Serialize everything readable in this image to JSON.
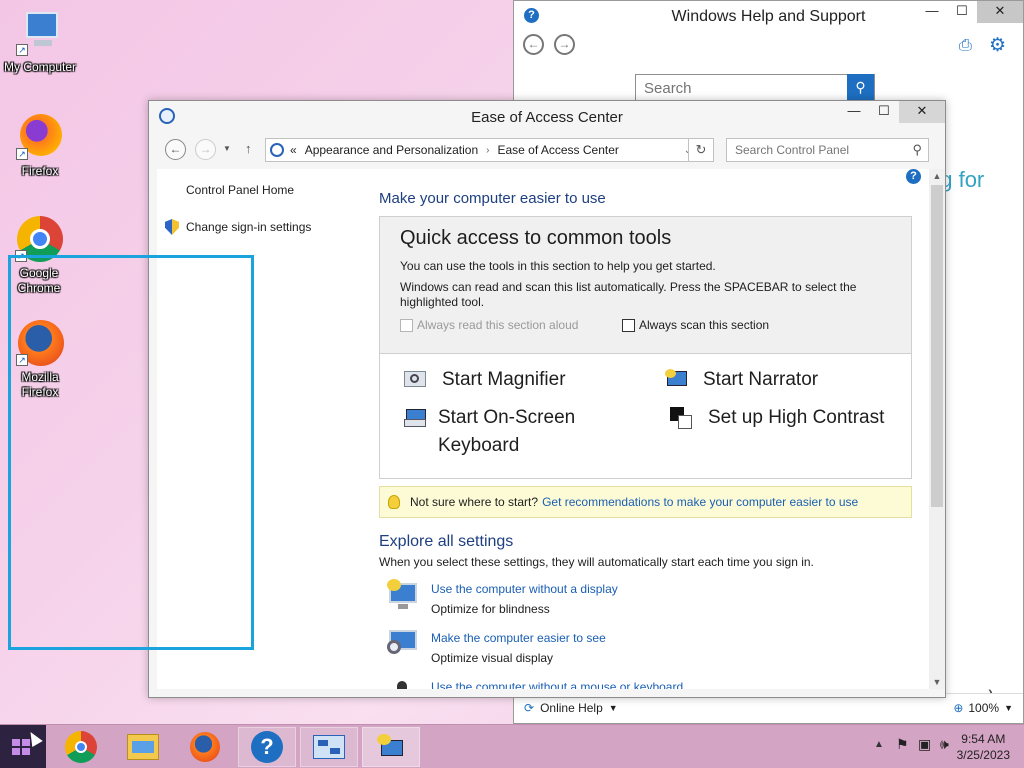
{
  "desktop": {
    "icons": [
      {
        "label": "My Computer"
      },
      {
        "label": "Firefox"
      },
      {
        "label": "Google Chrome"
      },
      {
        "label": "Mozilla Firefox"
      }
    ]
  },
  "help_window": {
    "title": "Windows Help and Support",
    "search_placeholder": "Search",
    "partial_text": "ng for",
    "bottom_left": "Online Help",
    "zoom": "100%"
  },
  "eoa_window": {
    "title": "Ease of Access Center",
    "breadcrumb": [
      "«",
      "Appearance and Personalization",
      "Ease of Access Center"
    ],
    "search_placeholder": "Search Control Panel",
    "left_pane": {
      "home": "Control Panel Home",
      "signin": "Change sign-in settings"
    },
    "main": {
      "heading": "Make your computer easier to use",
      "quick": {
        "title": "Quick access to common tools",
        "p1": "You can use the tools in this section to help you get started.",
        "p2": "Windows can read and scan this list automatically.  Press the SPACEBAR to select the highlighted tool.",
        "chk_read": "Always read this section aloud",
        "chk_scan": "Always scan this section"
      },
      "tools": {
        "magnifier": "Start Magnifier",
        "narrator": "Start Narrator",
        "keyboard": "Start On-Screen Keyboard",
        "contrast": "Set up High Contrast"
      },
      "tip": {
        "text": "Not sure where to start?",
        "link": "Get recommendations to make your computer easier to use"
      },
      "explore": {
        "heading": "Explore all settings",
        "sub": "When you select these settings, they will automatically start each time you sign in.",
        "items": [
          {
            "link": "Use the computer without a display",
            "sub": "Optimize for blindness"
          },
          {
            "link": "Make the computer easier to see",
            "sub": "Optimize visual display"
          },
          {
            "link": "Use the computer without a mouse or keyboard",
            "sub": ""
          }
        ]
      }
    }
  },
  "taskbar": {
    "time": "9:54 AM",
    "date": "3/25/2023"
  }
}
